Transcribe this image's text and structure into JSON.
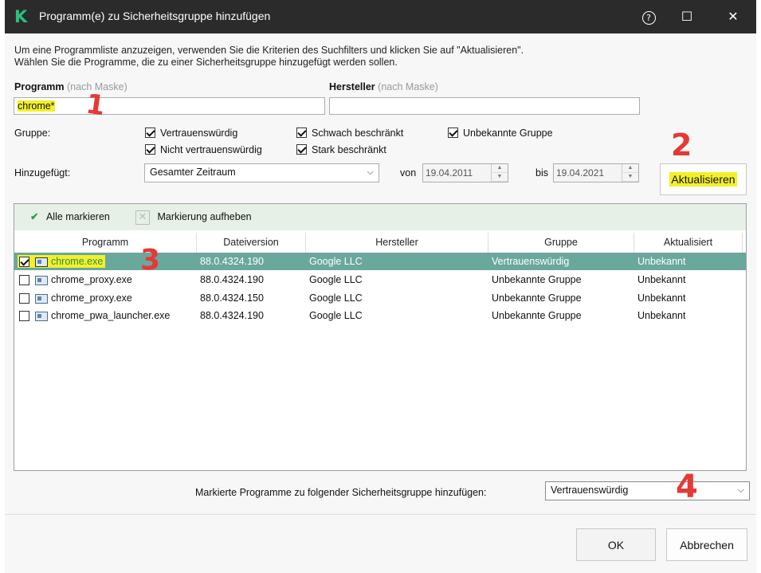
{
  "window": {
    "title": "Programm(e) zu Sicherheitsgruppe hinzufügen",
    "help_glyph": "?",
    "maximize_glyph": "☐",
    "close_glyph": "✕"
  },
  "intro": {
    "line1": "Um eine Programmliste anzuzeigen, verwenden Sie die Kriterien des Suchfilters und klicken Sie auf \"Aktualisieren\".",
    "line2": "Wählen Sie die Programme, die zu einer Sicherheitsgruppe hinzugefügt werden sollen."
  },
  "filters": {
    "program_label": "Programm",
    "program_hint": "(nach Maske)",
    "program_value": "chrome*",
    "vendor_label": "Hersteller",
    "vendor_hint": "(nach Maske)",
    "vendor_value": "",
    "group_label": "Gruppe:",
    "groups": [
      {
        "label": "Vertrauenswürdig",
        "checked": true
      },
      {
        "label": "Schwach beschränkt",
        "checked": true
      },
      {
        "label": "Unbekannte Gruppe",
        "checked": true
      },
      {
        "label": "Nicht vertrauenswürdig",
        "checked": true
      },
      {
        "label": "Stark beschränkt",
        "checked": true
      }
    ],
    "added_label": "Hinzugefügt:",
    "period_value": "Gesamter Zeitraum",
    "from_label": "von",
    "from_date": "19.04.2011",
    "to_label": "bis",
    "to_date": "19.04.2021",
    "refresh_button": "Aktualisieren"
  },
  "toolbar": {
    "select_all": "Alle markieren",
    "clear_selection": "Markierung aufheben"
  },
  "table": {
    "columns": [
      "Programm",
      "Dateiversion",
      "Hersteller",
      "Gruppe",
      "Aktualisiert"
    ],
    "rows": [
      {
        "checked": true,
        "name": "chrome.exe",
        "version": "88.0.4324.190",
        "vendor": "Google LLC",
        "group": "Vertrauenswürdig",
        "updated": "Unbekannt"
      },
      {
        "checked": false,
        "name": "chrome_proxy.exe",
        "version": "88.0.4324.190",
        "vendor": "Google LLC",
        "group": "Unbekannte Gruppe",
        "updated": "Unbekannt"
      },
      {
        "checked": false,
        "name": "chrome_proxy.exe",
        "version": "88.0.4324.150",
        "vendor": "Google LLC",
        "group": "Unbekannte Gruppe",
        "updated": "Unbekannt"
      },
      {
        "checked": false,
        "name": "chrome_pwa_launcher.exe",
        "version": "88.0.4324.190",
        "vendor": "Google LLC",
        "group": "Unbekannte Gruppe",
        "updated": "Unbekannt"
      }
    ]
  },
  "target": {
    "label": "Markierte Programme zu folgender Sicherheitsgruppe hinzufügen:",
    "value": "Vertrauenswürdig"
  },
  "footer": {
    "ok": "OK",
    "cancel": "Abbrechen"
  },
  "annotations": {
    "n1": "1",
    "n2": "2",
    "n3": "3",
    "n4": "4"
  },
  "colors": {
    "titlebar": "#2b2b2b",
    "brand": "#26c281",
    "selected_row": "#6aa89d",
    "highlight": "#f3f02a",
    "annotation": "#e53935"
  }
}
